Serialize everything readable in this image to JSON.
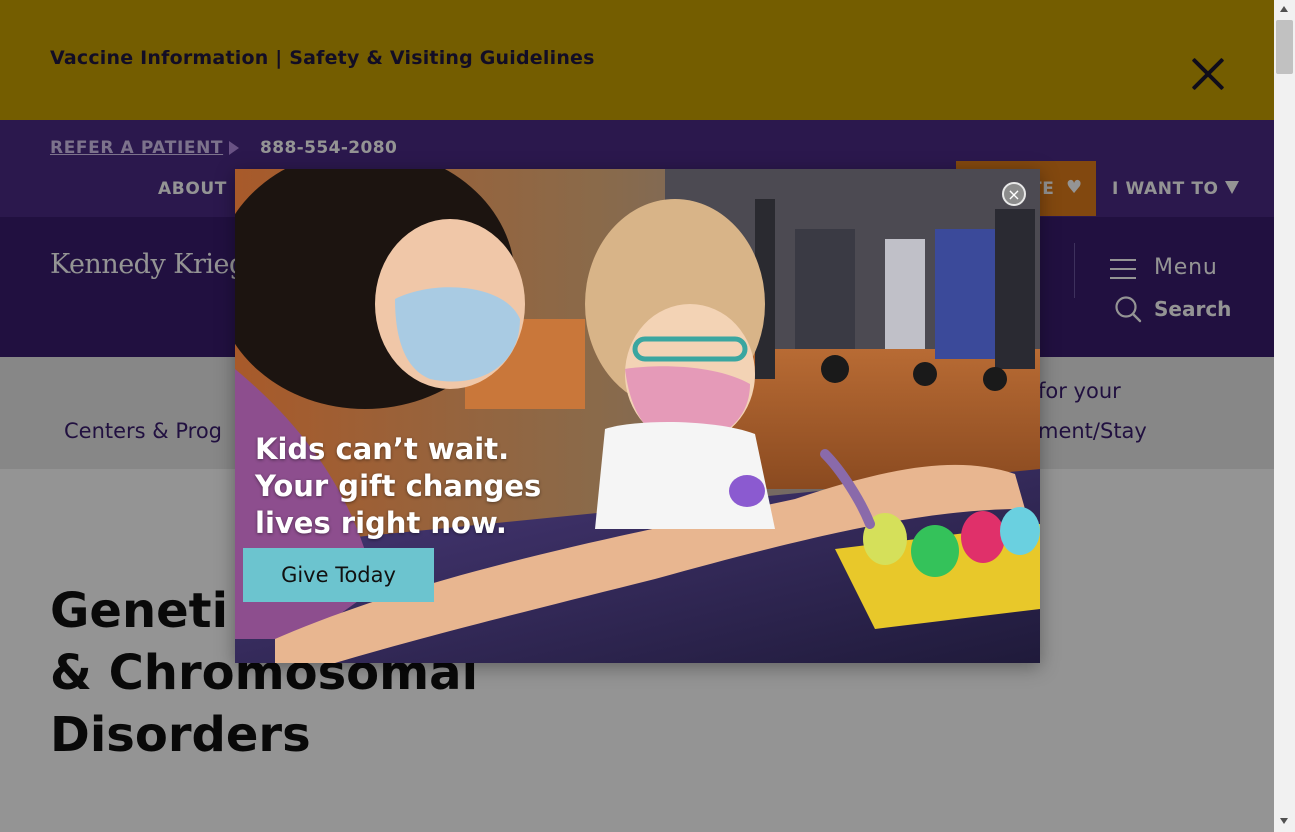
{
  "alert": {
    "text": "Vaccine Information | Safety & Visiting Guidelines",
    "close_icon": "close-x-icon"
  },
  "utility": {
    "refer_label": "REFER A PATIENT",
    "phone": "888-554-2080",
    "about_label": "ABOUT",
    "donate_label": "TE",
    "donate_icon": "heart-icon",
    "i_want_to_label": "I WANT TO"
  },
  "header": {
    "logo_text": "Kennedy Krieger",
    "menu_label": "Menu",
    "search_label": "Search"
  },
  "subnav": {
    "left_item": "Centers & Prog",
    "right_line1": "for your",
    "right_line2": "ment/Stay"
  },
  "main": {
    "title_lines": [
      "Geneti",
      "& Chromosomal",
      "Disorders"
    ]
  },
  "modal": {
    "headline_lines": [
      "Kids can’t wait.",
      "Your gift changes",
      "lives right now."
    ],
    "button_label": "Give Today",
    "close_glyph": "×"
  },
  "colors": {
    "alert_bg": "#c9a100",
    "utility_bg": "#4a2a86",
    "header_bg": "#3a1d6e",
    "donate_bg": "#e07c1a",
    "give_button_bg": "#6cc4cf"
  }
}
